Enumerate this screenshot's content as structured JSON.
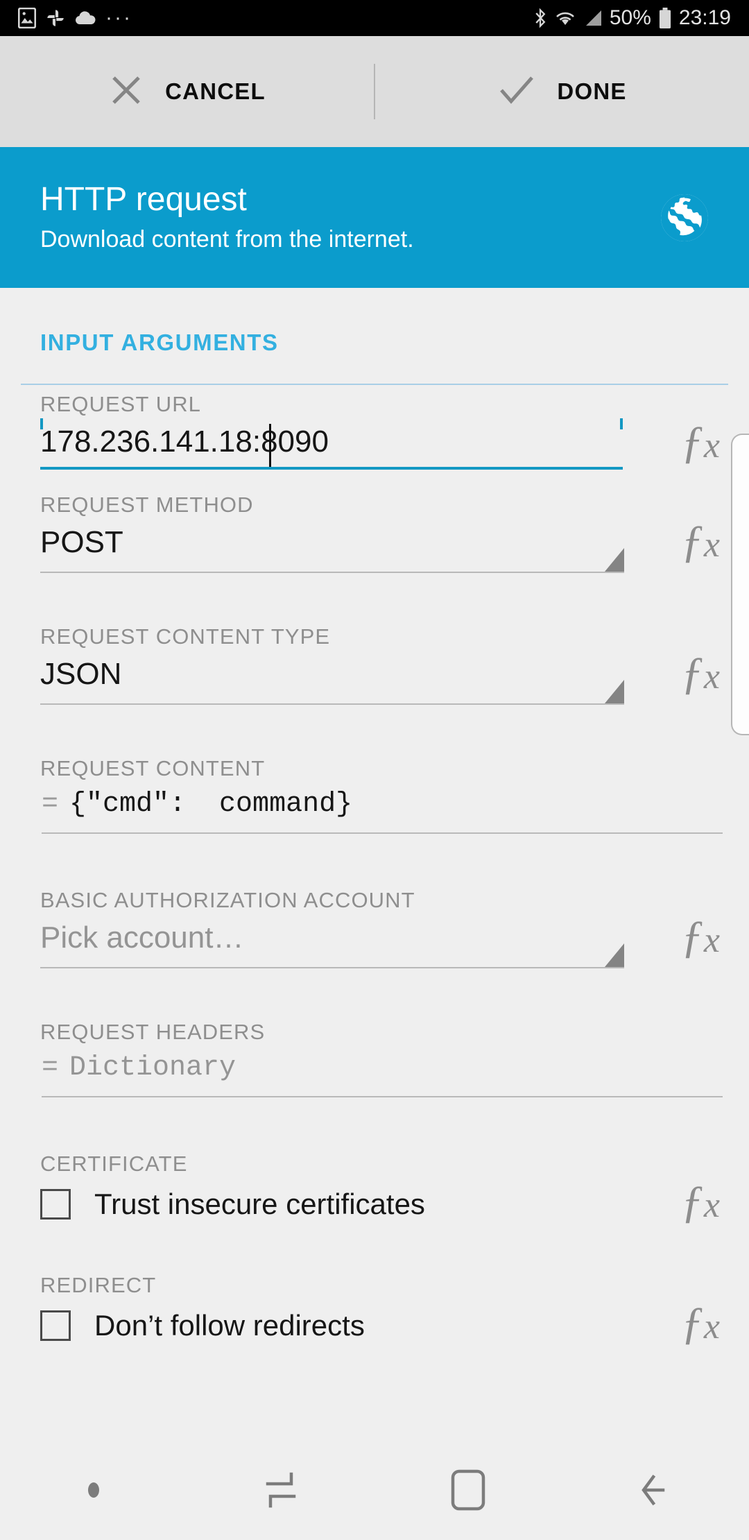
{
  "status_bar": {
    "icons_left": [
      "image-icon",
      "photos-pinwheel-icon",
      "cloud-icon",
      "more-dots-icon"
    ],
    "bluetooth": "bluetooth-icon",
    "wifi": "wifi-icon",
    "signal": "signal-icon",
    "battery_percent": "50%",
    "battery": "battery-icon",
    "time": "23:19"
  },
  "action_bar": {
    "cancel_label": "CANCEL",
    "cancel_icon": "close-x-icon",
    "done_label": "DONE",
    "done_icon": "check-icon"
  },
  "header": {
    "title": "HTTP request",
    "subtitle": "Download content from the internet.",
    "icon": "globe-icon",
    "background_color": "#0b9ccc"
  },
  "section": {
    "title": "INPUT ARGUMENTS",
    "title_color": "#33b0e0"
  },
  "fields": {
    "request_url": {
      "label": "REQUEST URL",
      "value": "178.236.141.18:8090",
      "fx_icon": "fx-icon",
      "focused": true,
      "accent_color": "#1398c3"
    },
    "request_method": {
      "label": "REQUEST METHOD",
      "value": "POST",
      "fx_icon": "fx-icon",
      "dropdown_icon": "spinner-triangle-icon"
    },
    "request_content_type": {
      "label": "REQUEST CONTENT TYPE",
      "value": "JSON",
      "fx_icon": "fx-icon",
      "dropdown_icon": "spinner-triangle-icon"
    },
    "request_content": {
      "label": "REQUEST CONTENT",
      "prefix": "=",
      "value": "{\"cmd\":  command}"
    },
    "basic_authorization_account": {
      "label": "BASIC AUTHORIZATION ACCOUNT",
      "placeholder": "Pick account…",
      "fx_icon": "fx-icon",
      "dropdown_icon": "spinner-triangle-icon"
    },
    "request_headers": {
      "label": "REQUEST HEADERS",
      "prefix": "=",
      "value": "Dictionary"
    },
    "certificate": {
      "label": "CERTIFICATE",
      "checkbox_label": "Trust insecure certificates",
      "checked": false,
      "fx_icon": "fx-icon"
    },
    "redirect": {
      "label": "REDIRECT",
      "checkbox_label": "Don’t follow redirects",
      "checked": false,
      "fx_icon": "fx-icon"
    }
  },
  "nav_bar": {
    "items": [
      "nav-dot-icon",
      "recents-icon",
      "home-icon",
      "back-icon"
    ]
  }
}
